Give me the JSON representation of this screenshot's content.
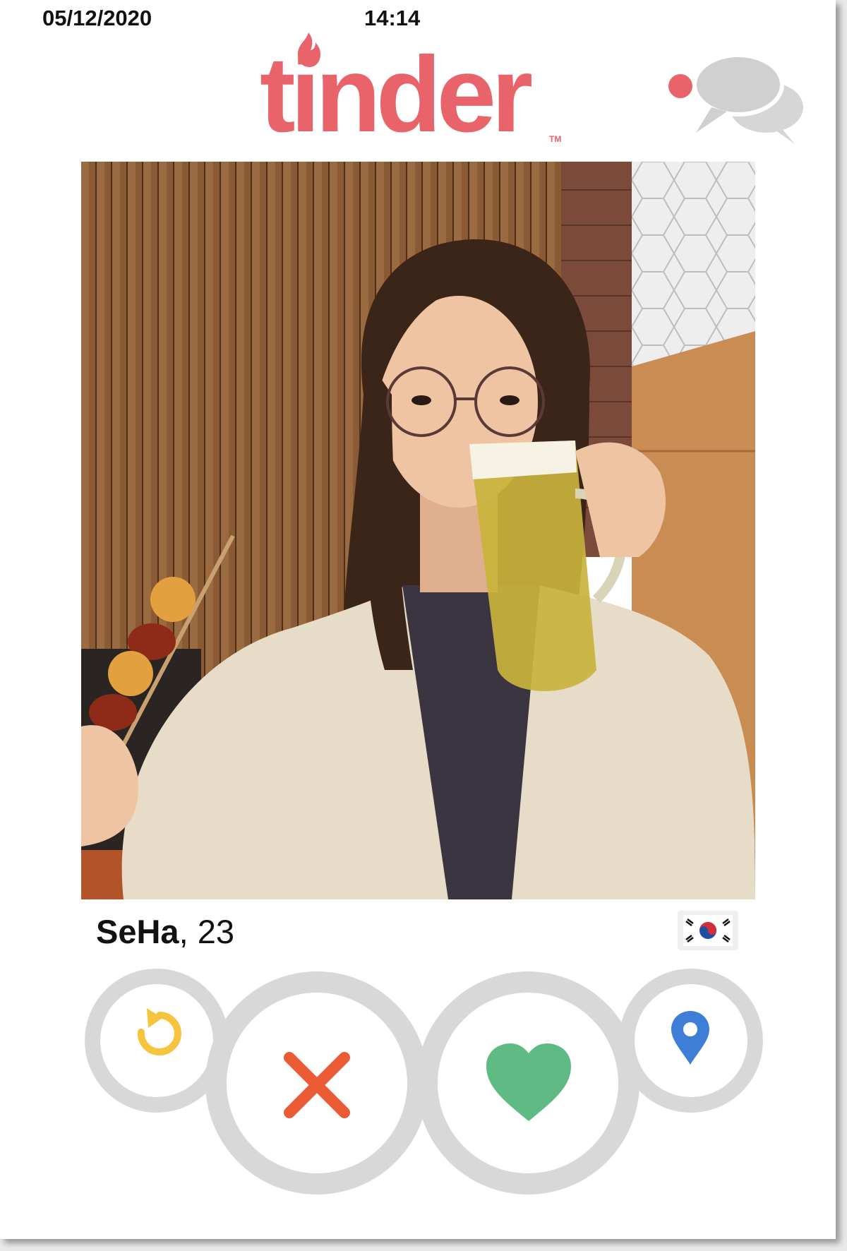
{
  "status": {
    "date": "05/12/2020",
    "time": "14:14"
  },
  "app": {
    "logo_text": "tinder",
    "trademark": "TM",
    "brand_color": "#e8636a"
  },
  "header": {
    "chat_icon": "chat-bubbles-icon",
    "notification_dot_color": "#e8636a"
  },
  "photo": {
    "description_icon": "profile-photo"
  },
  "profile": {
    "name": "SeHa",
    "separator": ", ",
    "age": "23",
    "flag": "south-korea-flag-icon"
  },
  "actions": [
    {
      "name": "rewind",
      "icon": "rewind-icon",
      "color": "#f6c53d"
    },
    {
      "name": "nope",
      "icon": "close-icon",
      "color": "#ea5a33"
    },
    {
      "name": "like",
      "icon": "heart-icon",
      "color": "#5fbb83"
    },
    {
      "name": "location",
      "icon": "location-pin-icon",
      "color": "#3f7ed6"
    }
  ]
}
